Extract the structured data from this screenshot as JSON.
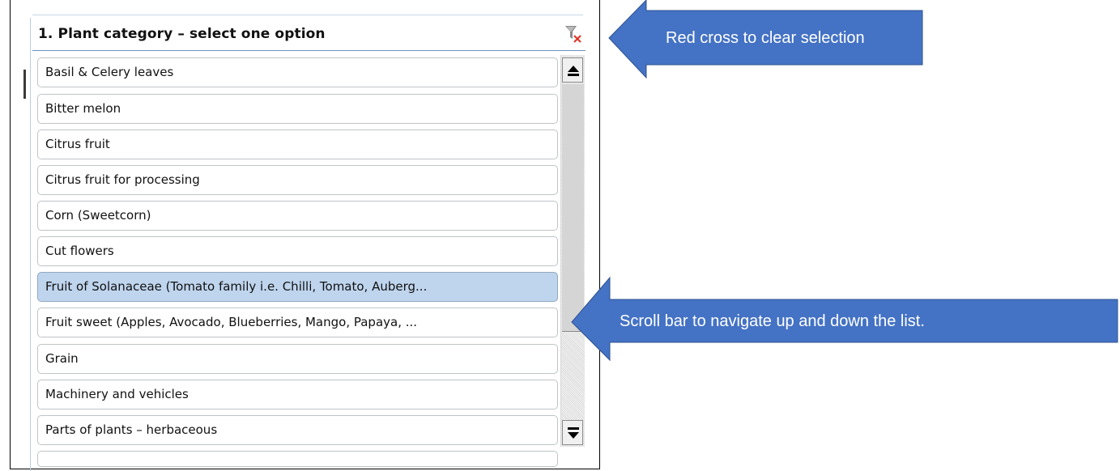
{
  "panel": {
    "title": "1. Plant category – select one option",
    "clear_icon": "filter-clear-icon"
  },
  "list": {
    "items": [
      {
        "label": "Basil & Celery leaves",
        "selected": false
      },
      {
        "label": "Bitter melon",
        "selected": false
      },
      {
        "label": "Citrus fruit",
        "selected": false
      },
      {
        "label": "Citrus fruit for processing",
        "selected": false
      },
      {
        "label": "Corn (Sweetcorn)",
        "selected": false
      },
      {
        "label": "Cut flowers",
        "selected": false
      },
      {
        "label": "Fruit of Solanaceae (Tomato family i.e. Chilli, Tomato, Auberg...",
        "selected": true
      },
      {
        "label": "Fruit sweet (Apples, Avocado, Blueberries, Mango, Papaya, ...",
        "selected": false
      },
      {
        "label": "Grain",
        "selected": false
      },
      {
        "label": "Machinery and vehicles",
        "selected": false
      },
      {
        "label": "Parts of plants – herbaceous",
        "selected": false
      }
    ]
  },
  "callouts": {
    "clear": "Red cross to clear selection",
    "scroll": "Scroll bar to navigate up and down the list."
  },
  "colors": {
    "callout_fill": "#4472c4",
    "selected_item": "#bfd5ee",
    "header_underline": "#6a93c1"
  }
}
